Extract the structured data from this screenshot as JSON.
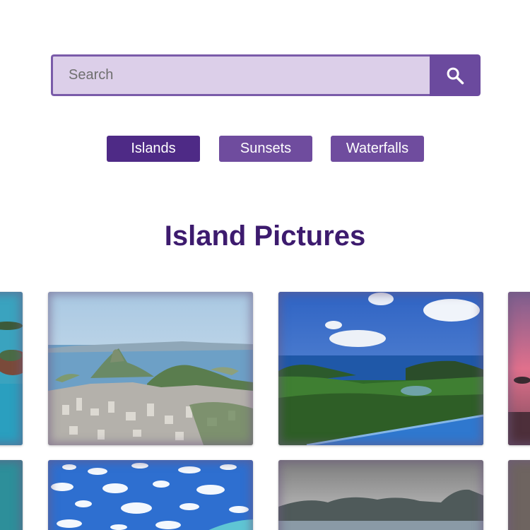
{
  "search": {
    "placeholder": "Search",
    "value": ""
  },
  "categories": [
    {
      "label": "Islands",
      "active": true
    },
    {
      "label": "Sunsets",
      "active": false
    },
    {
      "label": "Waterfalls",
      "active": false
    }
  ],
  "gallery": {
    "title": "Island Pictures"
  },
  "colors": {
    "accent": "#6b4a9e",
    "accent_dark": "#4e2a86",
    "heading": "#3d1b6e",
    "search_bg": "#dccfe9"
  },
  "icons": {
    "search_button": "search-icon"
  }
}
